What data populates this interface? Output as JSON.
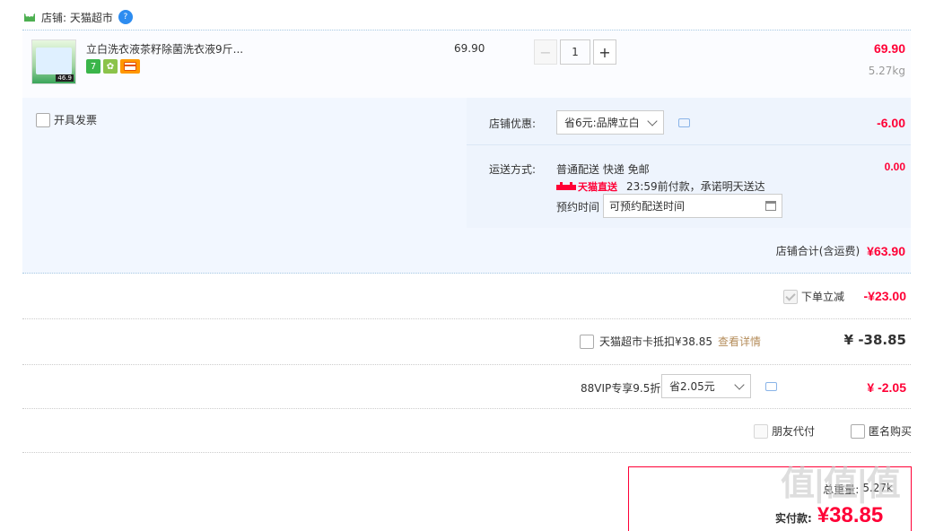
{
  "shop": {
    "label": "店铺: 天猫超市"
  },
  "item": {
    "title": "立白洗衣液茶籽除菌洗衣液9斤...",
    "thumb_price": "46.9",
    "badges": [
      "7",
      "✿",
      ""
    ],
    "unit_price": "69.90",
    "quantity": "1",
    "total": "69.90",
    "weight": "5.27kg"
  },
  "options": {
    "invoice_label": "开具发票",
    "discount_label": "店铺优惠:",
    "discount_select": "省6元:品牌立白",
    "discount_value": "-6.00",
    "shipping_label": "运送方式:",
    "shipping_method": "普通配送 快递 免邮",
    "shipping_value": "0.00",
    "tmall_tag": "天猫直送",
    "delivery_promise": "23:59前付款，承诺明天送达",
    "appointment_label": "预约时间",
    "appointment_placeholder": "可预约配送时间",
    "shop_total_label": "店铺合计(含运费)",
    "shop_total_value": "¥63.90"
  },
  "rows": {
    "instant_discount_label": "下单立减",
    "instant_discount_value": "-¥23.00",
    "card_label": "天猫超市卡抵扣¥38.85",
    "card_link": "查看详情",
    "card_value": "¥ -38.85",
    "vip_label": "88VIP专享9.5折",
    "vip_select": "省2.05元",
    "vip_value": "¥ -2.05",
    "friend_pay_label": "朋友代付",
    "anonymous_label": "匿名购买"
  },
  "summary": {
    "weight_label": "总重量:",
    "weight_value": "5.27k",
    "pay_label": "实付款:",
    "pay_value": "¥38.85"
  },
  "watermark": "值|值|值"
}
